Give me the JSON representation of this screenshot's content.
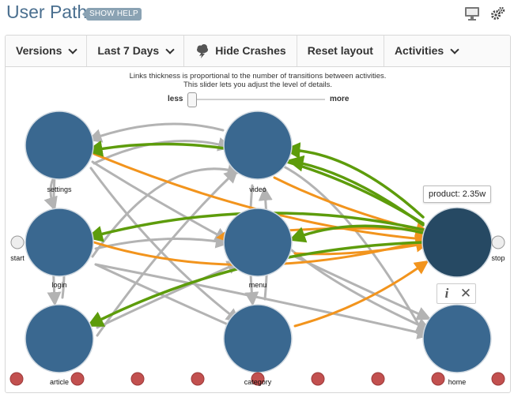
{
  "header": {
    "title": "User Path",
    "help_label": "SHOW HELP"
  },
  "toolbar": {
    "versions_label": "Versions",
    "range_label": "Last 7 Days",
    "crashes_label": "Hide Crashes",
    "reset_label": "Reset layout",
    "activities_label": "Activities"
  },
  "hint": {
    "line1": "Links thickness is proportional to the number of transitions between activities.",
    "line2": "This slider lets you adjust the level of details.",
    "less_label": "less",
    "more_label": "more",
    "slider_value": 0
  },
  "graph": {
    "nodes": {
      "settings": "settings",
      "video": "video",
      "login": "login",
      "menu": "menu",
      "product": "product",
      "article": "article",
      "category": "category",
      "home": "home",
      "start": "start",
      "stop": "stop"
    },
    "selected_node": "product",
    "tooltip": "product: 2.35w",
    "colors": {
      "node": "#3a6890",
      "node_selected": "#264963",
      "node_stroke": "#cfd8e0",
      "link_grey": "#b3b3b3",
      "link_green": "#5d9c0b",
      "link_orange": "#f2941d",
      "crash": "#c2504f",
      "endpoint": "#eeeeee"
    },
    "tools": {
      "info_icon": "i",
      "close_icon": "✕"
    }
  }
}
